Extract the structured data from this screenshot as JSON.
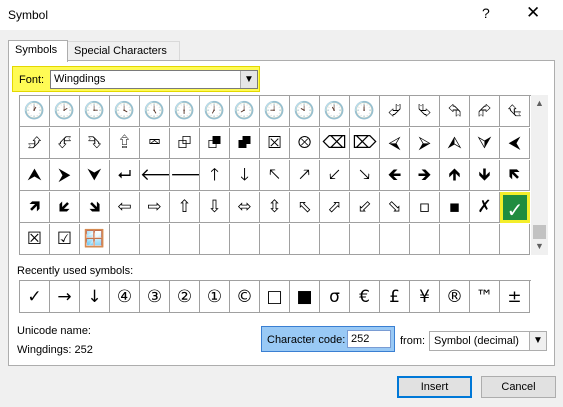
{
  "window": {
    "title": "Symbol",
    "help_label": "?",
    "close_label": "✕"
  },
  "tabs": [
    {
      "label": "Symbols",
      "active": true
    },
    {
      "label": "Special Characters",
      "active": false
    }
  ],
  "font": {
    "label": "Font:",
    "value": "Wingdings"
  },
  "symbol_grid": {
    "rows": [
      [
        "🕐",
        "🕑",
        "🕒",
        "🕓",
        "🕔",
        "🕕",
        "🕖",
        "🕗",
        "🕘",
        "🕙",
        "🕚",
        "🕛",
        "⮰",
        "⮱",
        "⮲",
        "⮳",
        "⮴"
      ],
      [
        "⮵",
        "⮶",
        "⮷",
        "⮸",
        "⮹",
        "⮺",
        "⮻",
        "⮼",
        "⮽",
        "⮾",
        "⌫",
        "⌦",
        "⮘",
        "⮚",
        "⮙",
        "⮛",
        "⮜"
      ],
      [
        "⮝",
        "⮞",
        "⮟",
        "⮠",
        "🡐",
        "🡒",
        "🡑",
        "🡓",
        "🡔",
        "🡕",
        "🡗",
        "🡖",
        "🡸",
        "🡺",
        "🡹",
        "🡻",
        "🡼"
      ],
      [
        "🡽",
        "🡿",
        "🡾",
        "⇦",
        "⇨",
        "⇧",
        "⇩",
        "⬄",
        "⇳",
        "⬁",
        "⬀",
        "⬃",
        "⬂",
        "▫",
        "▪",
        "✗",
        "✓"
      ],
      [
        "☒",
        "☑",
        "🪟",
        "",
        "",
        "",
        "",
        "",
        "",
        "",
        "",
        "",
        "",
        "",
        "",
        "",
        ""
      ]
    ],
    "selected": {
      "row": 3,
      "col": 16
    }
  },
  "recent": {
    "label": "Recently used symbols:",
    "symbols": [
      "✓",
      "→",
      "↓",
      "④",
      "③",
      "②",
      "①",
      "©",
      "□",
      "■",
      "σ",
      "€",
      "£",
      "¥",
      "®",
      "™",
      "±"
    ]
  },
  "unicode": {
    "label": "Unicode name:",
    "value": "Wingdings: 252"
  },
  "character_code": {
    "label": "Character code:",
    "value": "252"
  },
  "from": {
    "label": "from:",
    "value": "Symbol (decimal)"
  },
  "buttons": {
    "insert": "Insert",
    "cancel": "Cancel"
  },
  "colors": {
    "highlight_yellow": "#fffb55",
    "selected_cell": "#218c3f",
    "code_highlight": "#99c9f5"
  }
}
